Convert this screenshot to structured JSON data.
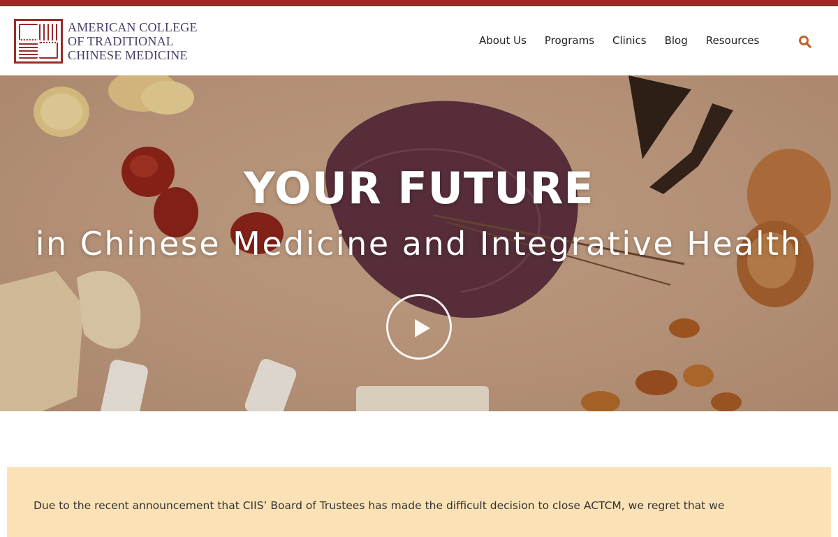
{
  "brand": {
    "name_line1": "AMERICAN COLLEGE",
    "name_line2": "OF TRADITIONAL",
    "name_line3": "CHINESE MEDICINE",
    "accent_color": "#9b2a2b",
    "text_color": "#4b3d66"
  },
  "nav": {
    "items": [
      {
        "label": "About Us"
      },
      {
        "label": "Programs"
      },
      {
        "label": "Clinics"
      },
      {
        "label": "Blog"
      },
      {
        "label": "Resources"
      }
    ],
    "search_icon": "search-icon",
    "search_color": "#c0632f"
  },
  "hero": {
    "headline": "YOUR FUTURE",
    "subline": "in Chinese Medicine and Integrative Health",
    "play_icon": "play-icon"
  },
  "notice": {
    "text": "Due to the recent announcement that CIIS’ Board of Trustees has made the difficult decision to close ACTCM, we regret that we",
    "background": "#fbe2b6"
  }
}
